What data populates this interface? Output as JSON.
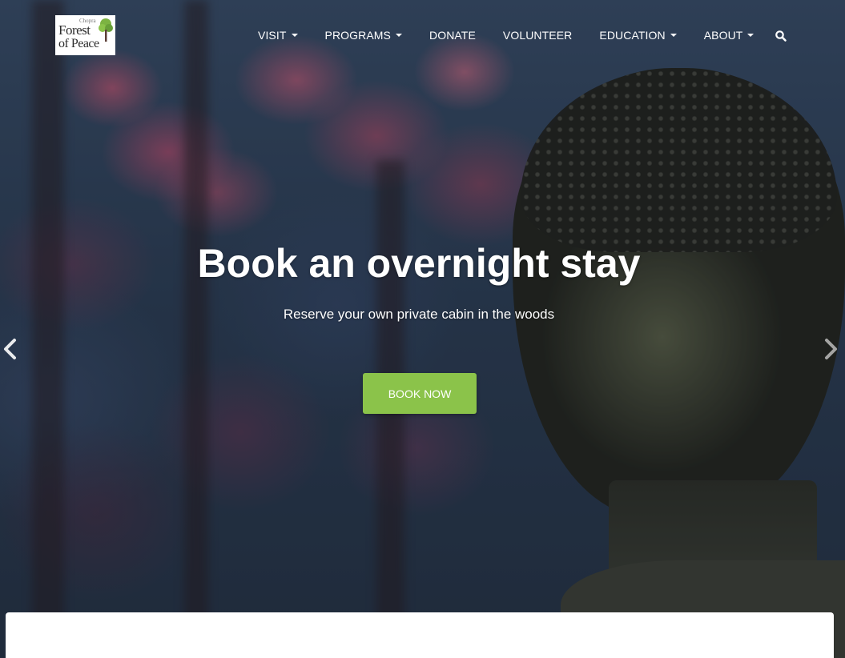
{
  "logo": {
    "small_text": "Chopra",
    "line1": "Forest",
    "line2": "of Peace"
  },
  "nav": {
    "items": [
      {
        "label": "VISIT",
        "dropdown": true
      },
      {
        "label": "PROGRAMS",
        "dropdown": true
      },
      {
        "label": "DONATE",
        "dropdown": false
      },
      {
        "label": "VOLUNTEER",
        "dropdown": false
      },
      {
        "label": "EDUCATION",
        "dropdown": true
      },
      {
        "label": "ABOUT",
        "dropdown": true
      }
    ],
    "search_icon": "search-icon"
  },
  "hero": {
    "title": "Book an overnight stay",
    "subtitle": "Reserve your own private cabin in the woods",
    "button_label": "BOOK NOW",
    "prev_icon": "chevron-left-icon",
    "next_icon": "chevron-right-icon"
  },
  "colors": {
    "accent": "#8bc34a",
    "text": "#ffffff",
    "card": "#ffffff"
  }
}
